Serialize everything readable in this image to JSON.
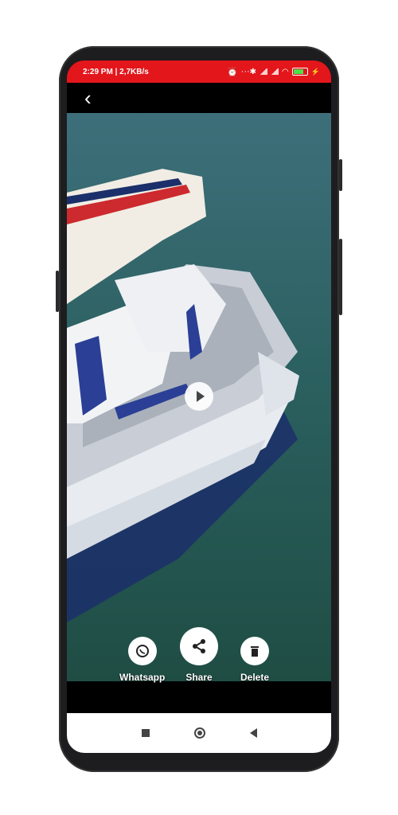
{
  "status_bar": {
    "left_text": "2:29 PM | 2,7KB/s",
    "extra_icons": [
      "alarm-icon",
      "clock-icon",
      "more-dots-icon"
    ],
    "right_icons": [
      "bluetooth-icon",
      "signal-icon",
      "signal-icon",
      "wifi-icon",
      "battery-icon"
    ],
    "battery_color": "#4be04b",
    "bar_color": "#e3161b"
  },
  "toolbar": {
    "back_glyph": "‹"
  },
  "actions": {
    "whatsapp_label": "Whatsapp",
    "share_label": "Share",
    "delete_label": "Delete"
  },
  "media": {
    "play_icon": "play-icon"
  },
  "navbar": {
    "icons": [
      "recents-square-icon",
      "home-circle-icon",
      "back-triangle-icon"
    ]
  }
}
